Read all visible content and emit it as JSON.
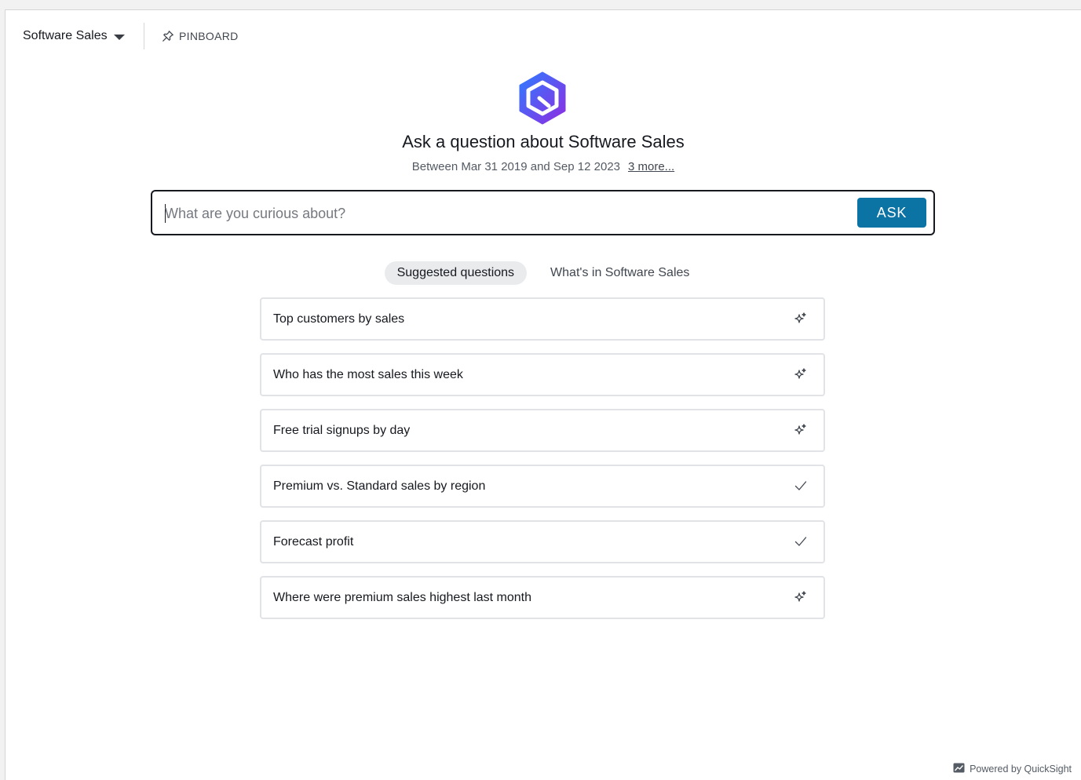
{
  "header": {
    "topic_label": "Software Sales",
    "pinboard_label": "PINBOARD"
  },
  "hero": {
    "title": "Ask a question about Software Sales",
    "date_range": "Between Mar 31 2019 and Sep 12 2023",
    "more_link": "3 more..."
  },
  "search": {
    "placeholder": "What are you curious about?",
    "ask_label": "ASK"
  },
  "tabs": [
    {
      "label": "Suggested questions",
      "active": true
    },
    {
      "label": "What's in Software Sales",
      "active": false
    }
  ],
  "questions": [
    {
      "text": "Top customers by sales",
      "icon": "sparkle-icon"
    },
    {
      "text": "Who has the most sales this week",
      "icon": "sparkle-icon"
    },
    {
      "text": "Free trial signups by day",
      "icon": "sparkle-icon"
    },
    {
      "text": "Premium vs. Standard sales by region",
      "icon": "checkmark-icon"
    },
    {
      "text": "Forecast profit",
      "icon": "checkmark-icon"
    },
    {
      "text": "Where were premium sales highest last month",
      "icon": "sparkle-icon"
    }
  ],
  "footer": {
    "powered_by": "Powered by QuickSight"
  },
  "colors": {
    "accent": "#0c73a5",
    "logo_gradient": [
      "#3b6cff",
      "#8a2be2"
    ]
  }
}
